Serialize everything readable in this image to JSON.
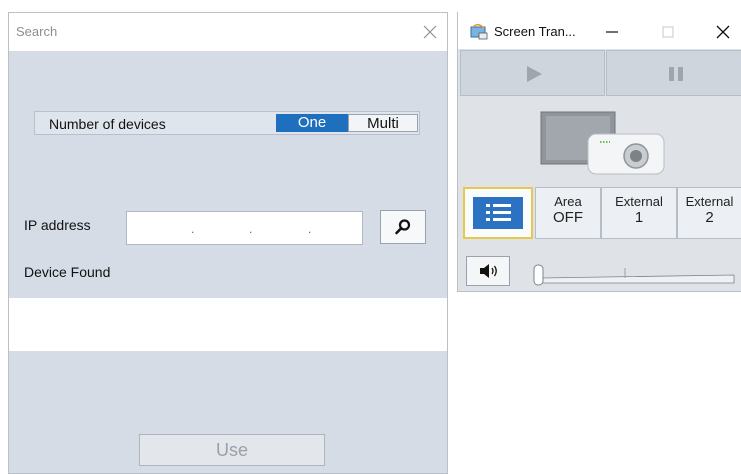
{
  "search_window": {
    "title": "Search",
    "number_of_devices_label": "Number of devices",
    "mode_options": [
      "One",
      "Multi"
    ],
    "mode_selected": "One",
    "ip_label": "IP address",
    "ip_dots": [
      ".",
      ".",
      "."
    ],
    "device_found_label": "Device Found",
    "use_button": "Use"
  },
  "screen_transfer": {
    "title": "Screen Tran...",
    "sources": [
      {
        "line1": "Area",
        "line2": "OFF"
      },
      {
        "line1": "External",
        "line2": "1"
      },
      {
        "line1": "External",
        "line2": "2"
      }
    ]
  },
  "colors": {
    "accent": "#1f6fbf",
    "panel_bg": "#d5dce6",
    "list_button_border": "#e5c94a"
  },
  "icons": [
    "close-icon",
    "search-icon",
    "play-icon",
    "pause-icon",
    "list-icon",
    "speaker-icon",
    "minimize-icon",
    "maximize-icon",
    "app-icon"
  ]
}
